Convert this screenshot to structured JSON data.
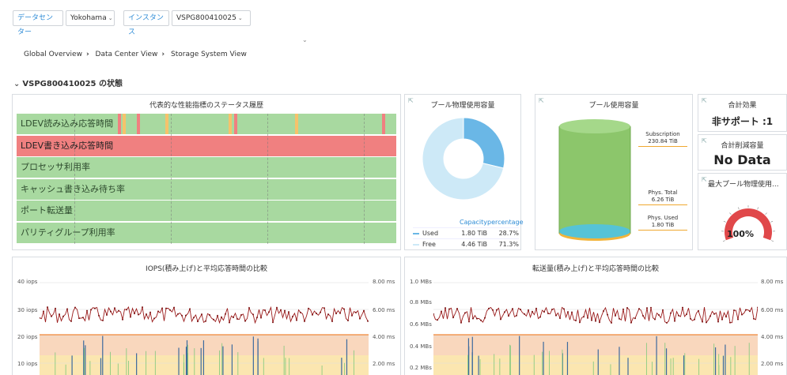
{
  "filters": {
    "datacenter_label": "データセンター",
    "datacenter_value": "Yokohama",
    "instance_label": "インスタンス",
    "instance_value": "VSPG800410025"
  },
  "breadcrumb": [
    "Global Overview",
    "Data Center View",
    "Storage System View"
  ],
  "section": {
    "title": "VSPG800410025 の状態"
  },
  "status_panel": {
    "title": "代表的な性能指標のステータス履歴",
    "rows": [
      {
        "label": "LDEV読み込み応答時間",
        "state": "ok"
      },
      {
        "label": "LDEV書き込み応答時間",
        "state": "alert"
      },
      {
        "label": "プロセッサ利用率",
        "state": "ok"
      },
      {
        "label": "キャッシュ書き込み待ち率",
        "state": "ok"
      },
      {
        "label": "ポート転送量",
        "state": "ok"
      },
      {
        "label": "パリティグループ利用率",
        "state": "ok"
      }
    ]
  },
  "pool_physical": {
    "title": "プール物理使用容量",
    "header_capacity": "Capacity",
    "header_percentage": "percentage",
    "rows": [
      {
        "label": "Used",
        "capacity": "1.80 TiB",
        "percentage": "28.7%",
        "color": "#6ab7e6"
      },
      {
        "label": "Free",
        "capacity": "4.46 TiB",
        "percentage": "71.3%",
        "color": "#cde9f7"
      }
    ],
    "used_fraction": 0.287
  },
  "pool_usage": {
    "title": "プール使用容量",
    "subscription_label": "Subscription",
    "subscription_value": "230.84 TiB",
    "phys_total_label": "Phys. Total",
    "phys_total_value": "6.26 TiB",
    "phys_used_label": "Phys. Used",
    "phys_used_value": "1.80 TiB"
  },
  "total_effect": {
    "title": "合計効果",
    "value": "非サポート :1"
  },
  "total_reduction": {
    "title": "合計削減容量",
    "value": "No Data"
  },
  "max_pool": {
    "title": "最大プール物理使用...",
    "value": "100%",
    "fraction": 1.0
  },
  "chart_data": [
    {
      "type": "line",
      "title": "IOPS(積み上げ)と平均応答時間の比較",
      "yticks_left": [
        "40 iops",
        "30 iops",
        "20 iops",
        "10 iops"
      ],
      "yticks_right": [
        "8.00 ms",
        "6.00 ms",
        "4.00 ms",
        "2.00 ms"
      ],
      "series": [
        {
          "name": "",
          "color": "#9b1c1c",
          "approx_range": [
            27,
            33
          ]
        }
      ]
    },
    {
      "type": "line",
      "title": "転送量(積み上げ)と平均応答時間の比較",
      "yticks_left": [
        "1.0 MBs",
        "0.8 MBs",
        "0.6 MBs",
        "0.4 MBs",
        "0.2 MBs"
      ],
      "yticks_right": [
        "8.00 ms",
        "6.00 ms",
        "4.00 ms",
        "2.00 ms"
      ],
      "series": [
        {
          "name": "",
          "color": "#9b1c1c",
          "approx_range": [
            0.74,
            0.86
          ]
        }
      ]
    }
  ]
}
